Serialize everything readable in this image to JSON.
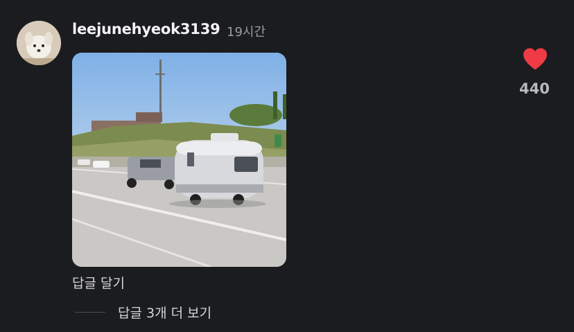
{
  "comment": {
    "username": "leejunehyeok3139",
    "time_ago": "19시간",
    "reply_label": "답글 달기",
    "more_replies_label": "답글 3개 더 보기"
  },
  "like": {
    "count": "440",
    "icon": "heart-icon",
    "color": "#ee3b45"
  },
  "media": {
    "description_icon": "gif-image"
  }
}
